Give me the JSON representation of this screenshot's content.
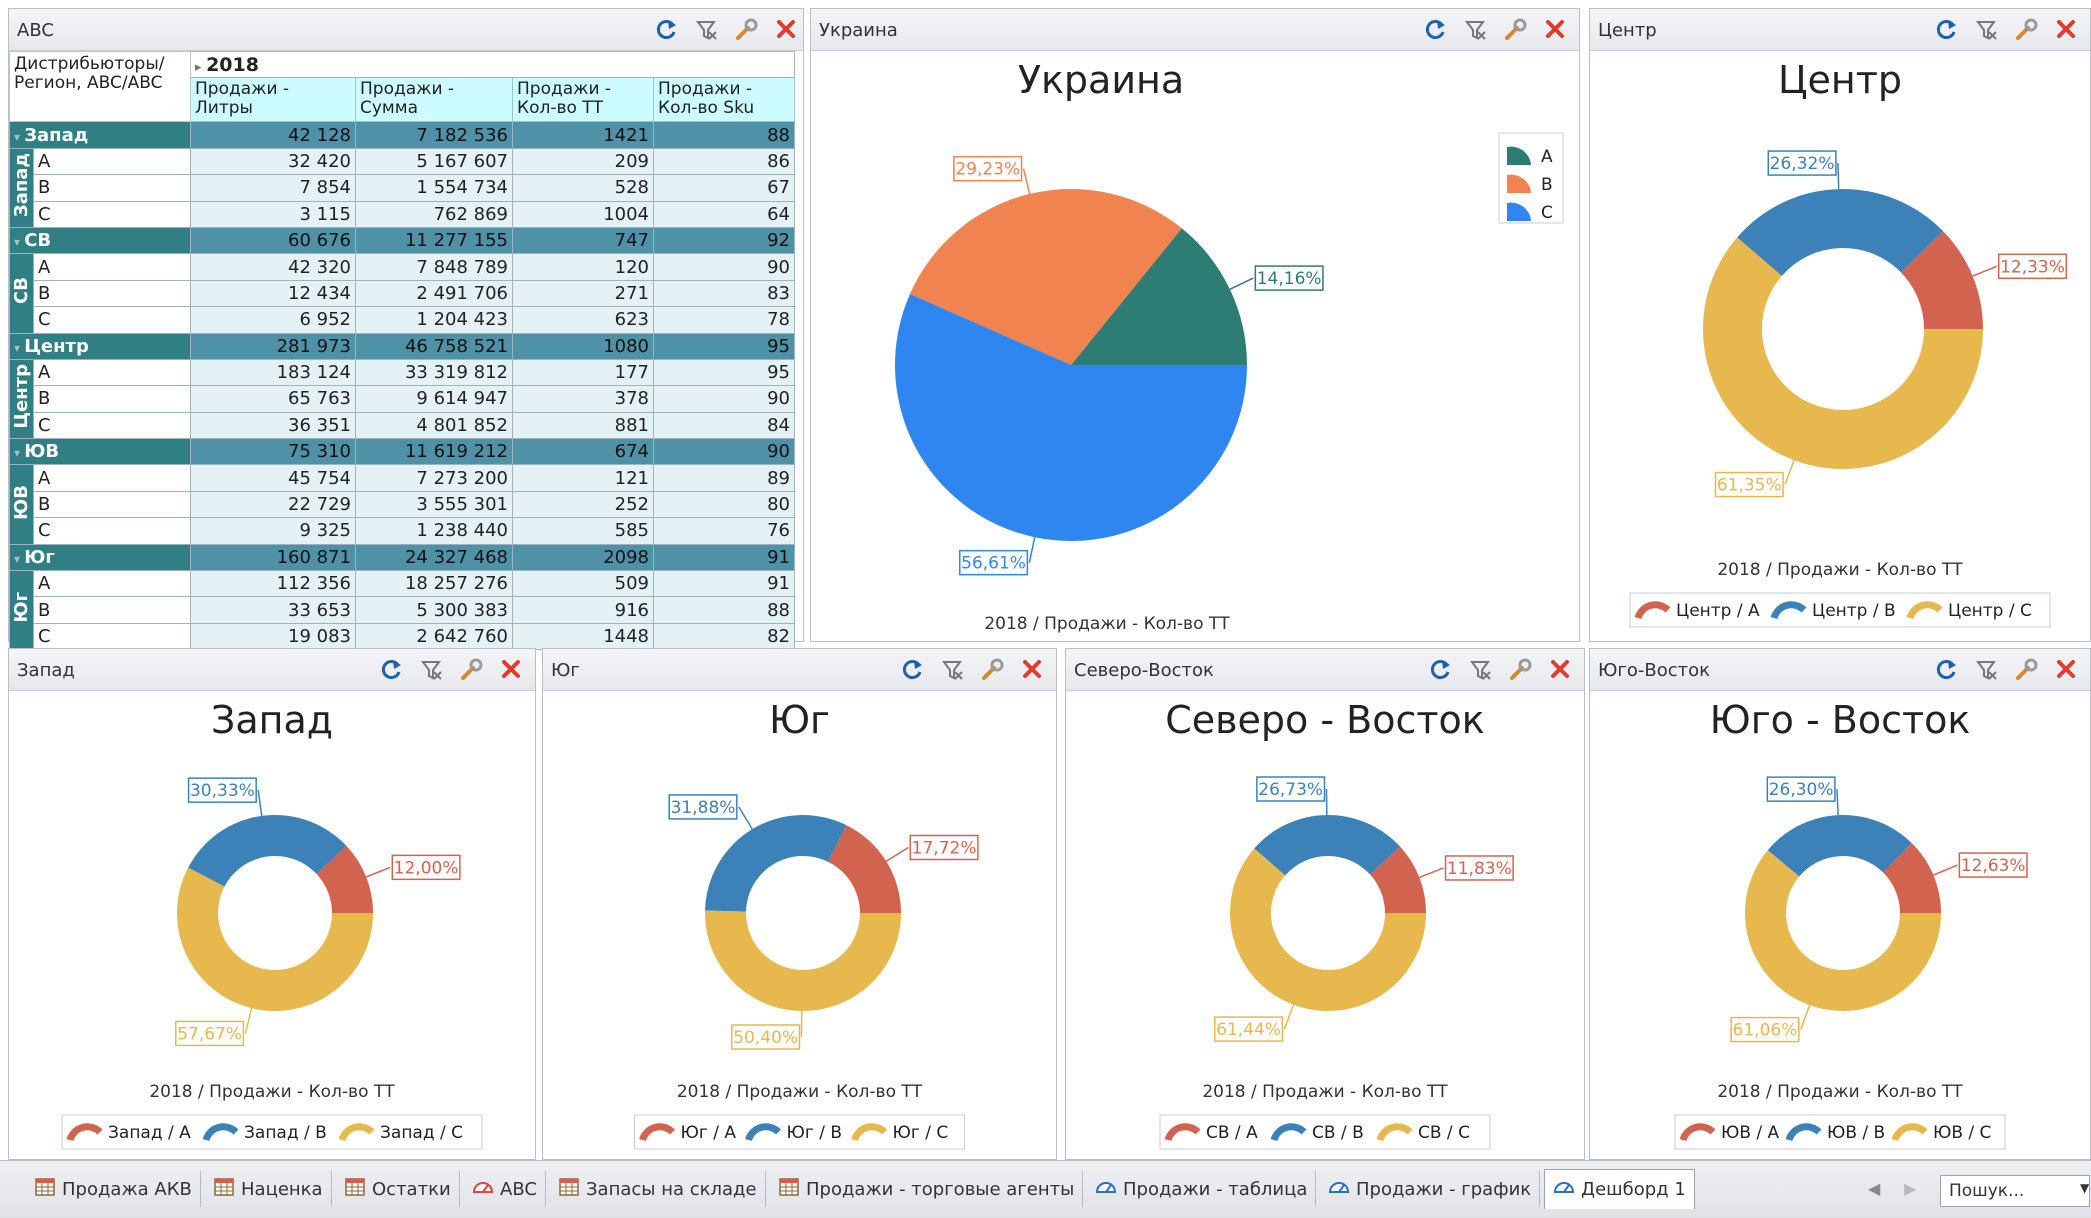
{
  "abc_panel": {
    "title": "ABC",
    "corner_header": "Дистрибьюторы/Регион, ABC/ABC",
    "year": "2018",
    "columns": [
      "Продажи - Литры",
      "Продажи - Сумма",
      "Продажи - Кол-во ТТ",
      "Продажи - Кол-во Sku"
    ],
    "groups": [
      {
        "name": "Запад",
        "totals": [
          "42 128",
          "7 182 536",
          "1421",
          "88"
        ],
        "rows": [
          {
            "label": "A",
            "values": [
              "32 420",
              "5 167 607",
              "209",
              "86"
            ]
          },
          {
            "label": "B",
            "values": [
              "7 854",
              "1 554 734",
              "528",
              "67"
            ]
          },
          {
            "label": "C",
            "values": [
              "3 115",
              "762 869",
              "1004",
              "64"
            ]
          }
        ]
      },
      {
        "name": "СВ",
        "totals": [
          "60 676",
          "11 277 155",
          "747",
          "92"
        ],
        "rows": [
          {
            "label": "A",
            "values": [
              "42 320",
              "7 848 789",
              "120",
              "90"
            ]
          },
          {
            "label": "B",
            "values": [
              "12 434",
              "2 491 706",
              "271",
              "83"
            ]
          },
          {
            "label": "C",
            "values": [
              "6 952",
              "1 204 423",
              "623",
              "78"
            ]
          }
        ]
      },
      {
        "name": "Центр",
        "totals": [
          "281 973",
          "46 758 521",
          "1080",
          "95"
        ],
        "rows": [
          {
            "label": "A",
            "values": [
              "183 124",
              "33 319 812",
              "177",
              "95"
            ]
          },
          {
            "label": "B",
            "values": [
              "65 763",
              "9 614 947",
              "378",
              "90"
            ]
          },
          {
            "label": "C",
            "values": [
              "36 351",
              "4 801 852",
              "881",
              "84"
            ]
          }
        ]
      },
      {
        "name": "ЮВ",
        "totals": [
          "75 310",
          "11 619 212",
          "674",
          "90"
        ],
        "rows": [
          {
            "label": "A",
            "values": [
              "45 754",
              "7 273 200",
              "121",
              "89"
            ]
          },
          {
            "label": "B",
            "values": [
              "22 729",
              "3 555 301",
              "252",
              "80"
            ]
          },
          {
            "label": "C",
            "values": [
              "9 325",
              "1 238 440",
              "585",
              "76"
            ]
          }
        ]
      },
      {
        "name": "Юг",
        "totals": [
          "160 871",
          "24 327 468",
          "2098",
          "91"
        ],
        "rows": [
          {
            "label": "A",
            "values": [
              "112 356",
              "18 257 276",
              "509",
              "91"
            ]
          },
          {
            "label": "B",
            "values": [
              "33 653",
              "5 300 383",
              "916",
              "88"
            ]
          },
          {
            "label": "C",
            "values": [
              "19 083",
              "2 642 760",
              "1448",
              "82"
            ]
          }
        ]
      }
    ]
  },
  "panels": [
    {
      "id": "ukraine",
      "title": "Украина"
    },
    {
      "id": "center",
      "title": "Центр"
    },
    {
      "id": "west",
      "title": "Запад"
    },
    {
      "id": "south",
      "title": "Юг"
    },
    {
      "id": "northeast",
      "title": "Северо-Восток"
    },
    {
      "id": "southeast",
      "title": "Юго-Восток"
    }
  ],
  "colors": {
    "A_pie": "#2e7d74",
    "B_pie": "#f0834f",
    "C_pie": "#2f86f0",
    "A_donut": "#d2644f",
    "B_donut": "#3c82b9",
    "C_donut": "#e6b84d"
  },
  "chart_data": [
    {
      "id": "ukraine",
      "type": "pie",
      "title": "Украина",
      "caption": "2018 / Продажи - Кол-во ТТ",
      "legend": [
        "A",
        "B",
        "C"
      ],
      "legend_position": "top-right",
      "labels": [
        "A",
        "B",
        "C"
      ],
      "values": [
        14.16,
        29.23,
        56.61
      ],
      "value_labels": [
        "14,16%",
        "29,23%",
        "56,61%"
      ]
    },
    {
      "id": "center",
      "type": "pie",
      "donut": true,
      "title": "Центр",
      "caption": "2018 / Продажи - Кол-во ТТ",
      "legend": [
        "Центр / A",
        "Центр / B",
        "Центр / C"
      ],
      "legend_position": "bottom",
      "labels": [
        "A",
        "B",
        "C"
      ],
      "values": [
        12.33,
        26.32,
        61.35
      ],
      "value_labels": [
        "12,33%",
        "26,32%",
        "61,35%"
      ]
    },
    {
      "id": "west",
      "type": "pie",
      "donut": true,
      "title": "Запад",
      "caption": "2018 / Продажи - Кол-во ТТ",
      "legend": [
        "Запад / A",
        "Запад / B",
        "Запад / C"
      ],
      "legend_position": "bottom",
      "labels": [
        "A",
        "B",
        "C"
      ],
      "values": [
        12.0,
        30.33,
        57.67
      ],
      "value_labels": [
        "12,00%",
        "30,33%",
        "57,67%"
      ]
    },
    {
      "id": "south",
      "type": "pie",
      "donut": true,
      "title": "Юг",
      "caption": "2018 / Продажи - Кол-во ТТ",
      "legend": [
        "Юг / A",
        "Юг / B",
        "Юг / C"
      ],
      "legend_position": "bottom",
      "labels": [
        "A",
        "B",
        "C"
      ],
      "values": [
        17.72,
        31.88,
        50.4
      ],
      "value_labels": [
        "17,72%",
        "31,88%",
        "50,40%"
      ]
    },
    {
      "id": "northeast",
      "type": "pie",
      "donut": true,
      "title": "Северо - Восток",
      "caption": "2018 / Продажи - Кол-во ТТ",
      "legend": [
        "СВ / A",
        "СВ / B",
        "СВ / C"
      ],
      "legend_position": "bottom",
      "labels": [
        "A",
        "B",
        "C"
      ],
      "values": [
        11.83,
        26.73,
        61.44
      ],
      "value_labels": [
        "11,83%",
        "26,73%",
        "61,44%"
      ]
    },
    {
      "id": "southeast",
      "type": "pie",
      "donut": true,
      "title": "Юго - Восток",
      "caption": "2018 / Продажи - Кол-во ТТ",
      "legend": [
        "ЮВ / A",
        "ЮВ / B",
        "ЮВ / C"
      ],
      "legend_position": "bottom",
      "labels": [
        "A",
        "B",
        "C"
      ],
      "values": [
        12.63,
        26.3,
        61.06
      ],
      "value_labels": [
        "12,63%",
        "26,30%",
        "61,06%"
      ]
    }
  ],
  "tabs": [
    {
      "label": "Продажа АКВ",
      "icon": "table-icon"
    },
    {
      "label": "Наценка",
      "icon": "table-icon"
    },
    {
      "label": "Остатки",
      "icon": "table-icon"
    },
    {
      "label": "ABC",
      "icon": "dashboard-icon"
    },
    {
      "label": "Запасы на складе",
      "icon": "table-icon"
    },
    {
      "label": "Продажи - торговые агенты",
      "icon": "table-icon"
    },
    {
      "label": "Продажи - таблица",
      "icon": "dashboard-icon"
    },
    {
      "label": "Продажи - график",
      "icon": "dashboard-icon"
    },
    {
      "label": "Дешборд 1",
      "icon": "dashboard-icon",
      "active": true
    }
  ],
  "search": {
    "placeholder": "Пошук..."
  }
}
